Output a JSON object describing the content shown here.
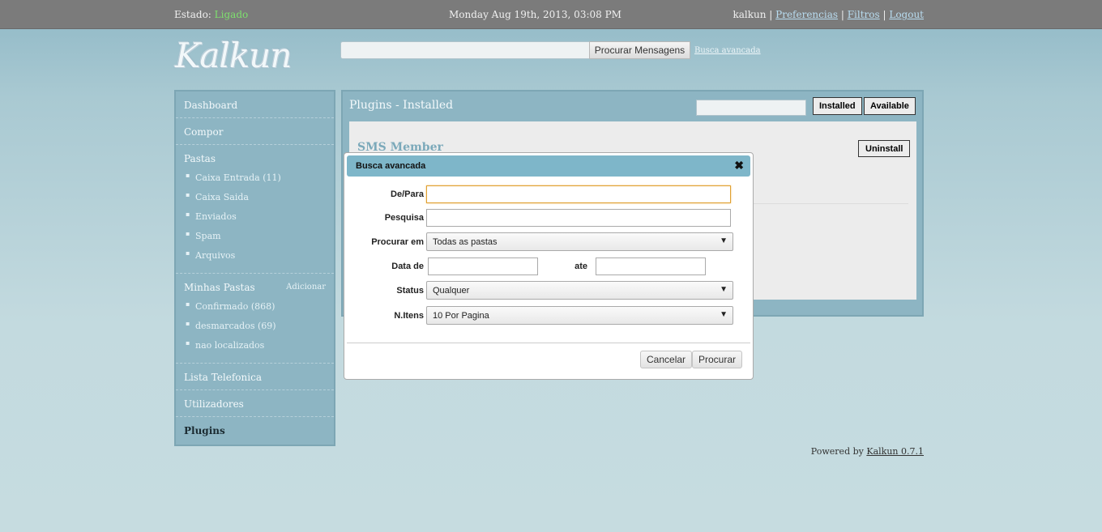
{
  "topbar": {
    "status_label": "Estado:",
    "status_value": "Ligado",
    "date": "Monday Aug 19th, 2013, 03:08 PM",
    "username": "kalkun",
    "links": [
      "Preferencias",
      "Filtros",
      "Logout"
    ]
  },
  "logo": {
    "text": "Kalkun"
  },
  "search": {
    "value": "",
    "button_label": "Procurar Mensagens",
    "advanced_link": "Busca avancada"
  },
  "sidebar": {
    "dashboard": "Dashboard",
    "compose": "Compor",
    "folders_title": "Pastas",
    "folders": [
      "Caixa Entrada (11)",
      "Caixa Saida",
      "Enviados",
      "Spam",
      "Arquivos"
    ],
    "my_folders_title": "Minhas Pastas",
    "my_folders_add": "Adicionar",
    "my_folders": [
      "Confirmado (868)",
      "desmarcados (69)",
      "nao localizados"
    ],
    "phonebook": "Lista Telefonica",
    "users": "Utilizadores",
    "plugins": "Plugins"
  },
  "main": {
    "title": "Plugins - Installed",
    "tab_installed": "Installed",
    "tab_available": "Available",
    "plugin_name": "SMS Member",
    "uninstall_label": "Uninstall"
  },
  "footer": {
    "prefix": "Powered by",
    "link": "Kalkun 0.7.1"
  },
  "dialog": {
    "title": "Busca avancada",
    "close_icon": "close-icon",
    "from_to_label": "De/Para",
    "from_to_value": "",
    "query_label": "Pesquisa",
    "query_value": "",
    "folder_label": "Procurar em",
    "folder_value": "Todas as pastas",
    "date_from_label": "Data de",
    "date_to_label": "ate",
    "status_label": "Status",
    "status_value": "Qualquer",
    "items_label": "N.Itens",
    "items_value": "10 Por Pagina",
    "cancel_label": "Cancelar",
    "search_label": "Procurar"
  }
}
